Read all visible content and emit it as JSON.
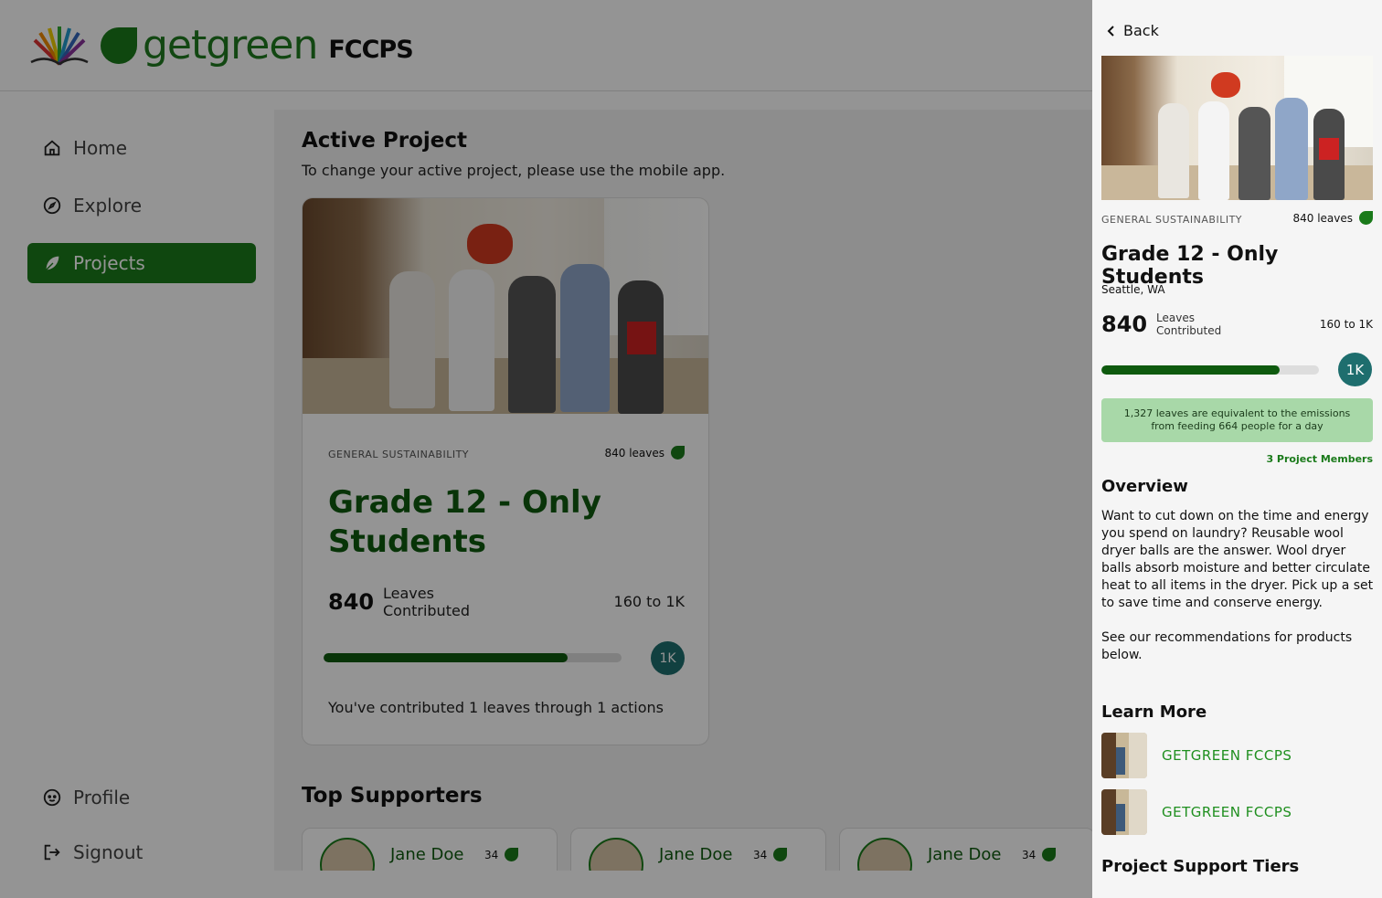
{
  "header": {
    "brand": "getgreen",
    "brand_suffix": "FCCPS"
  },
  "sidebar": {
    "items": [
      {
        "label": "Home",
        "icon": "home-icon"
      },
      {
        "label": "Explore",
        "icon": "compass-icon"
      },
      {
        "label": "Projects",
        "icon": "leaf-icon",
        "active": true
      }
    ],
    "bottom": [
      {
        "label": "Profile",
        "icon": "profile-icon"
      },
      {
        "label": "Signout",
        "icon": "signout-icon"
      }
    ]
  },
  "main": {
    "title": "Active Project",
    "subtitle": "To change your active project, please use the mobile app.",
    "card": {
      "category": "GENERAL SUSTAINABILITY",
      "leaves": "840 leaves",
      "title": "Grade 12 - Only Students",
      "count": "840",
      "count_label_1": "Leaves",
      "count_label_2": "Contributed",
      "range": "160 to 1K",
      "progress": 0.82,
      "badge": "1K",
      "contribution": "You've contributed 1 leaves through 1 actions"
    },
    "supporters_title": "Top Supporters",
    "supporters": [
      {
        "name": "Jane Doe",
        "count": "34"
      },
      {
        "name": "Jane Doe",
        "count": "34"
      },
      {
        "name": "Jane Doe",
        "count": "34"
      }
    ]
  },
  "panel": {
    "back": "Back",
    "category": "GENERAL SUSTAINABILITY",
    "leaves": "840 leaves",
    "title": "Grade 12 - Only Students",
    "location": "Seattle, WA",
    "count": "840",
    "count_label_1": "Leaves",
    "count_label_2": "Contributed",
    "range": "160 to 1K",
    "progress": 0.82,
    "badge": "1K",
    "equivalence": "1,327 leaves are equivalent to the emissions from feeding 664 people for a day",
    "members": "3 Project Members",
    "overview_title": "Overview",
    "overview_p1": "Want to cut down on the time and energy you spend on laundry? Reusable wool dryer balls are the answer. Wool dryer balls absorb moisture and better circulate heat to all items in the dryer. Pick up a set to save time and conserve energy.",
    "overview_p2": "See our recommendations for products below.",
    "learn_more_title": "Learn More",
    "learn_more": [
      {
        "label": "GETGREEN FCCPS"
      },
      {
        "label": "GETGREEN FCCPS"
      }
    ],
    "tiers_title": "Project Support Tiers"
  },
  "colors": {
    "brand_green": "#1a7a1a",
    "progress_fill": "#0e5a0e",
    "badge_teal": "#1e6e6e",
    "equivalence_bg": "#a8d8a8"
  }
}
